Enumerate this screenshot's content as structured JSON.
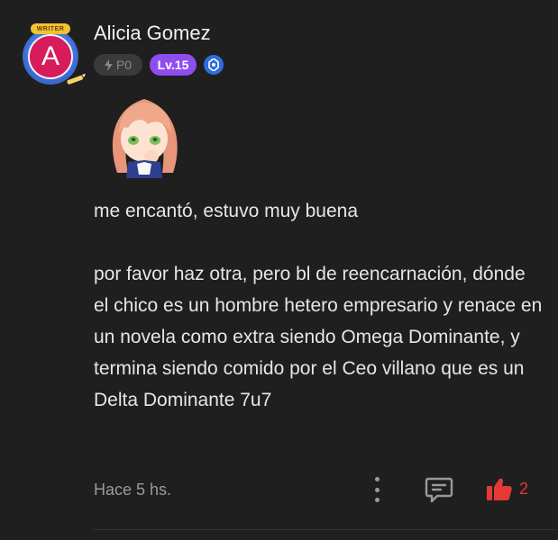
{
  "user": {
    "name": "Alicia Gomez",
    "avatar_letter": "A",
    "writer_tag": "WRITER",
    "points_badge": "P0",
    "level_badge": "Lv.15"
  },
  "comment": {
    "line1": "me encantó, estuvo muy buena",
    "paragraph2": "por favor haz otra, pero bl de reencarnación, dónde el chico es un hombre hetero empresario y renace en un novela como extra siendo Omega Dominante, y termina siendo comido por el Ceo villano que es un Delta Dominante 7u7"
  },
  "footer": {
    "time": "Hace 5 hs.",
    "like_count": "2"
  },
  "colors": {
    "background": "#1f1f1f",
    "avatar": "#d81b5b",
    "level_badge": "#8f4df0",
    "verified": "#2d6de0",
    "like": "#e53935"
  },
  "icons": {
    "more": "more-vertical-icon",
    "comment": "comment-icon",
    "like": "thumbs-up-icon",
    "verified": "verified-icon",
    "lightning": "lightning-icon"
  }
}
